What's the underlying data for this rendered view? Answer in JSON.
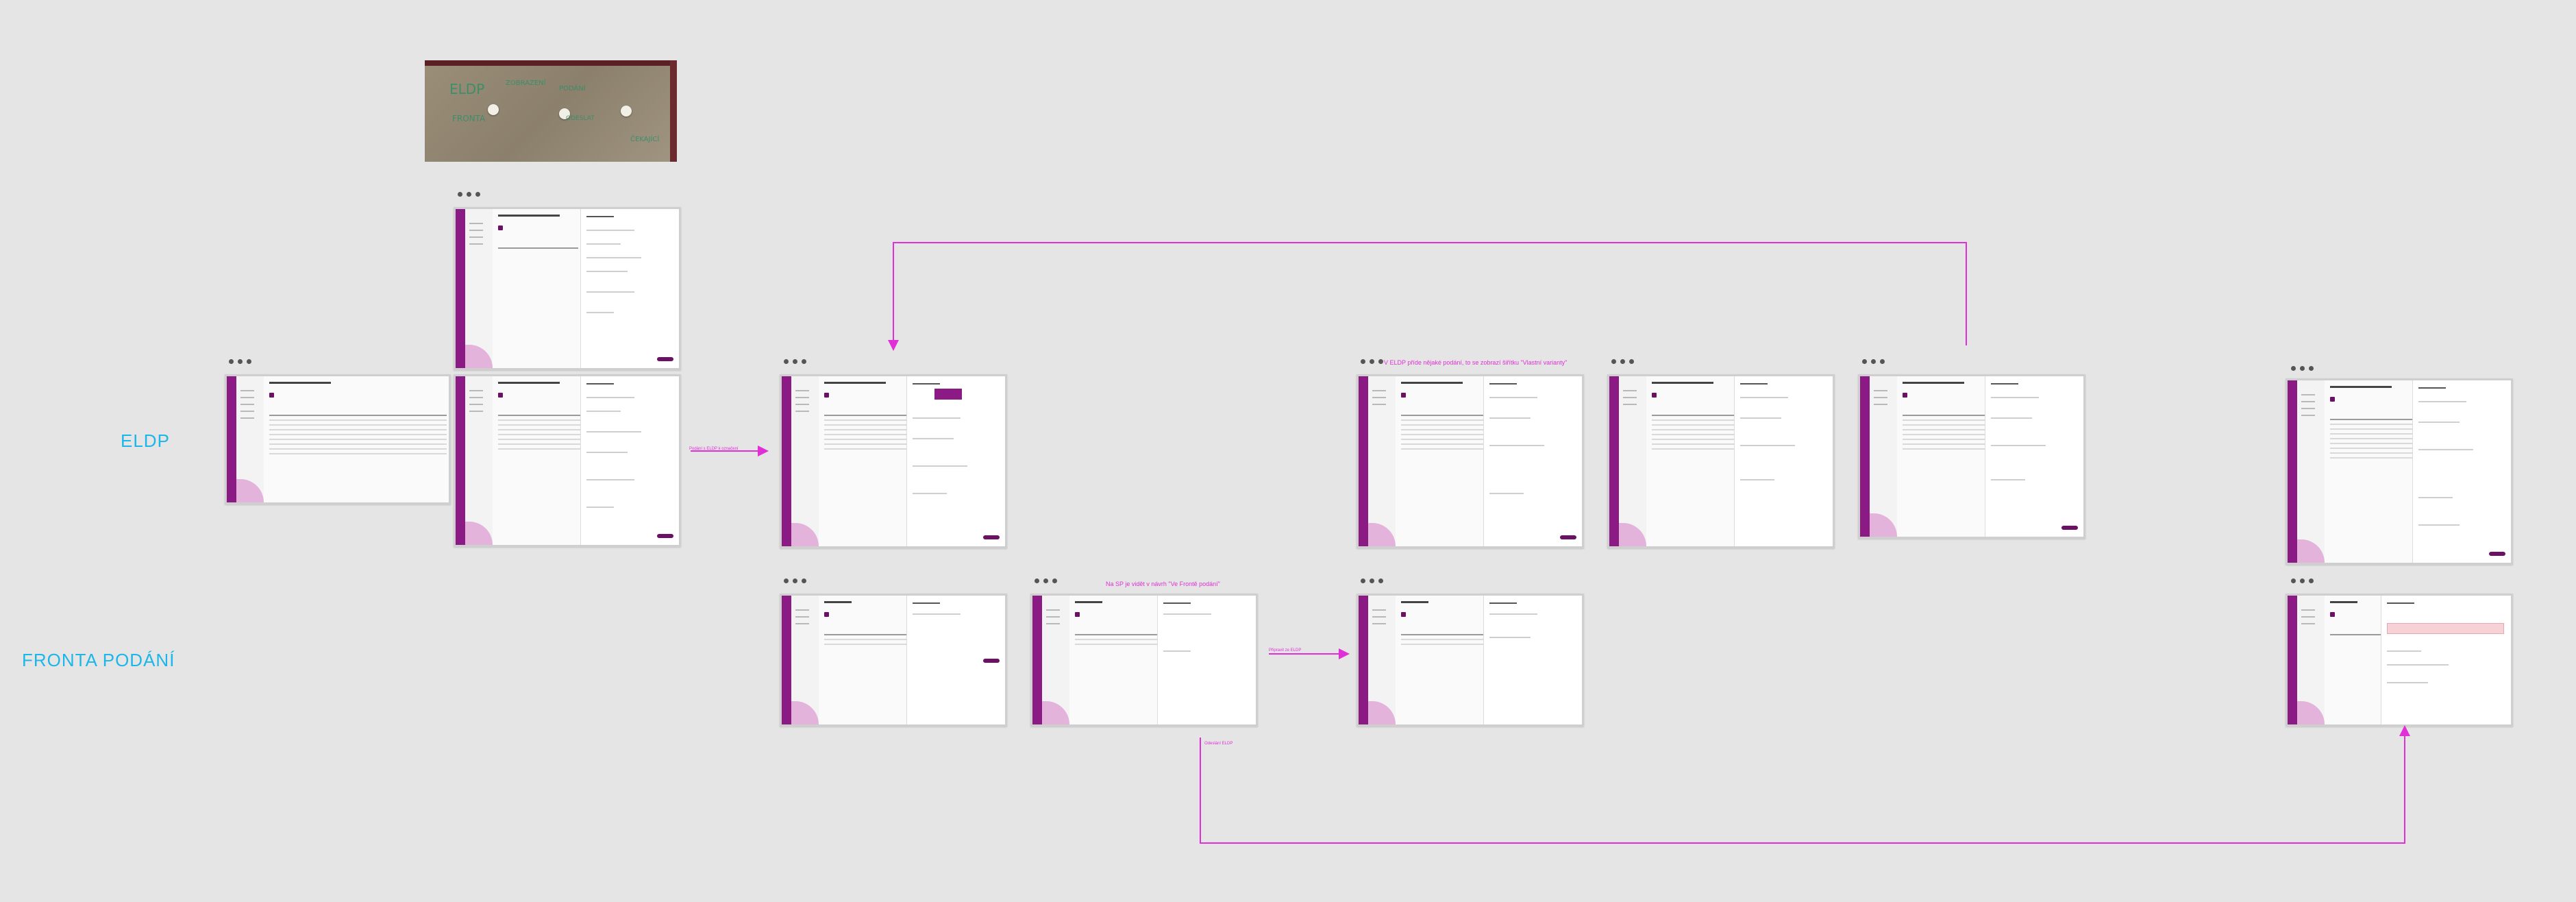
{
  "labels": {
    "eldp": "ELDP",
    "fronta": "FRONTA PODÁNÍ"
  },
  "notes": {
    "eldp_banner": "V ELDP příde nějaké podání, to se zobrazí šiřítku \"Vlastní varianty\"",
    "fronta_banner": "Na SP je vidět v návrh \"Ve Frontě podání\"",
    "small_left": "Podání s ELDP k označení",
    "small_middle": "Připravit ze ELDP",
    "small_bottom": "Odeslání ELDP"
  },
  "photo": {
    "words": [
      "ELDP",
      "ZOBRAZENÍ",
      "PODÁNÍ",
      "FRONTA",
      "ODESLAT",
      "ČEKAJÍCÍ"
    ]
  },
  "colors": {
    "label": "#1cb6e8",
    "flow": "#e02fd6",
    "brand": "#8b1a84"
  },
  "screens": [
    {
      "id": "s1",
      "kind": "list"
    },
    {
      "id": "s2",
      "kind": "detail"
    },
    {
      "id": "s3",
      "kind": "detail"
    },
    {
      "id": "s4",
      "kind": "detail-menu"
    },
    {
      "id": "s5",
      "kind": "detail"
    },
    {
      "id": "s6",
      "kind": "detail"
    },
    {
      "id": "s7",
      "kind": "detail"
    },
    {
      "id": "s8",
      "kind": "detail"
    },
    {
      "id": "f1",
      "kind": "queue"
    },
    {
      "id": "f2",
      "kind": "queue"
    },
    {
      "id": "f3",
      "kind": "queue"
    },
    {
      "id": "f4",
      "kind": "queue-alert"
    }
  ]
}
